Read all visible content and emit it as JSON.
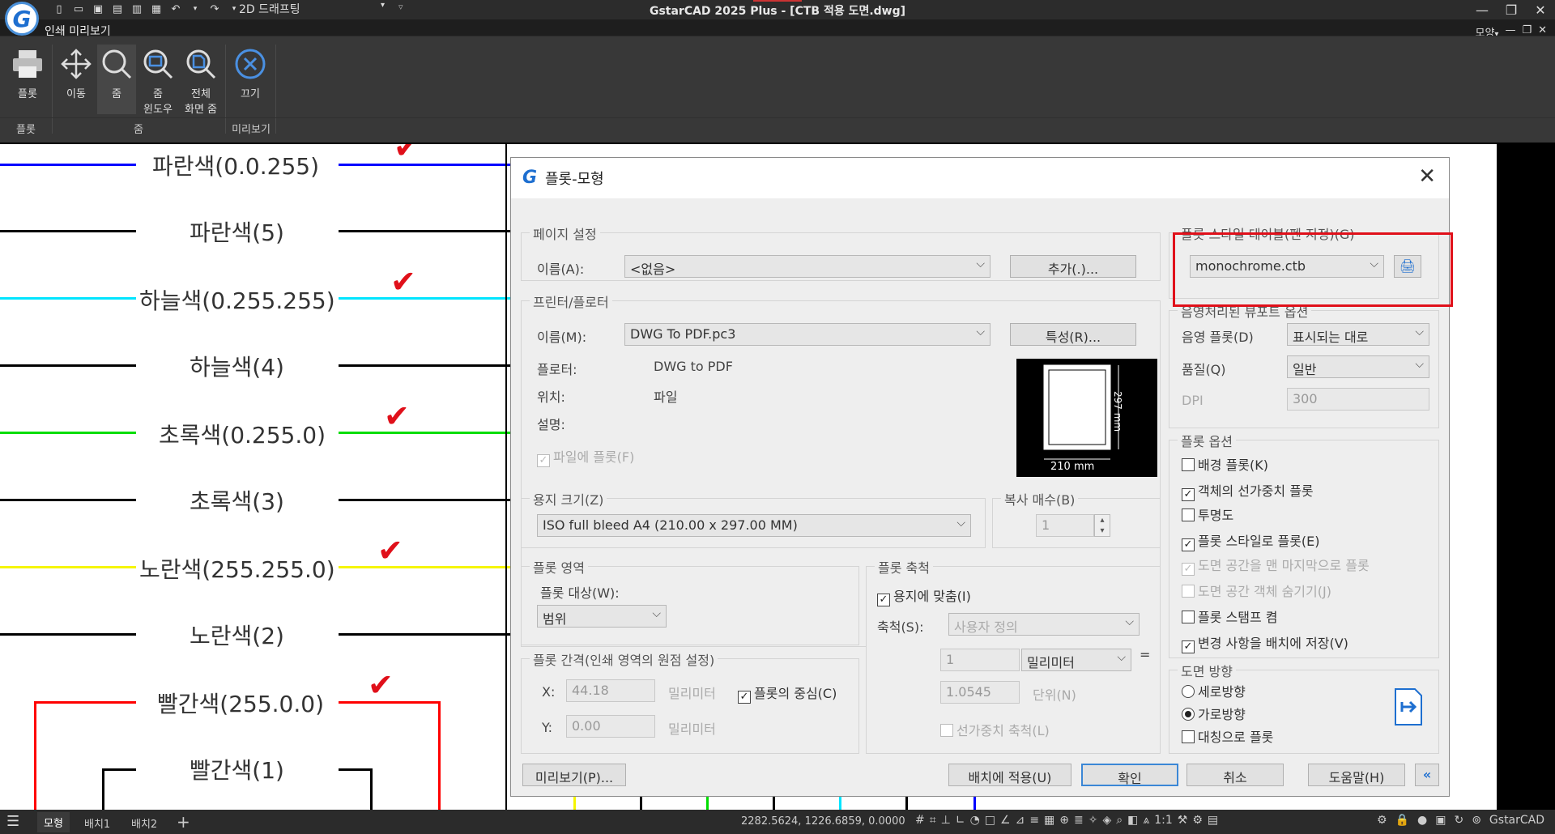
{
  "app": {
    "title": "GstarCAD 2025 Plus - [CTB 적용 도면.dwg]",
    "workspace": "2D 드래프팅",
    "logo_letter": "G"
  },
  "ribbon": {
    "tab": "인쇄 미리보기",
    "right_menu": "모양",
    "buttons": {
      "plot": "플롯",
      "pan": "이동",
      "zoom": "줌",
      "zoom_window_1": "줌",
      "zoom_window_2": "윈도우",
      "zoom_extents_1": "전체",
      "zoom_extents_2": "화면 줌",
      "close": "끄기"
    },
    "groups": {
      "plot": "플롯",
      "zoom": "줌",
      "preview": "미리보기"
    }
  },
  "canvas": {
    "labels": [
      "파란색(0.0.255)",
      "파란색(5)",
      "하늘색(0.255.255)",
      "하늘색(4)",
      "초록색(0.255.0)",
      "초록색(3)",
      "노란색(255.255.0)",
      "노란색(2)",
      "빨간색(255.0.0)",
      "빨간색(1)"
    ],
    "colors": {
      "blue": "#0000ff",
      "cyan": "#00e5ff",
      "green": "#00dd00",
      "yellow": "#f5f500",
      "red": "#ff0000",
      "black": "#000000",
      "check": "#e0101a"
    },
    "check_mark": "✔"
  },
  "dialog": {
    "title": "플롯-모형",
    "page_setup": {
      "title": "페이지 설정",
      "name_label": "이름(A):",
      "name_value": "<없음>",
      "add_button": "추가(.)..."
    },
    "printer": {
      "title": "프린터/플로터",
      "name_label": "이름(M):",
      "name_value": "DWG To PDF.pc3",
      "properties_button": "특성(R)...",
      "plotter_label": "플로터:",
      "plotter_value": "DWG to PDF",
      "location_label": "위치:",
      "location_value": "파일",
      "description_label": "설명:",
      "plot_to_file": "파일에 플롯(F)",
      "preview_width": "210 mm",
      "preview_height": "297 mm"
    },
    "paper_size": {
      "title": "용지 크기(Z)",
      "value": "ISO full bleed A4 (210.00 x 297.00 MM)"
    },
    "copies": {
      "title": "복사 매수(B)",
      "value": "1"
    },
    "plot_area": {
      "title": "플롯 영역",
      "what_label": "플롯 대상(W):",
      "what_value": "범위"
    },
    "plot_offset": {
      "title": "플롯 간격(인쇄 영역의 원점 설정)",
      "x_label": "X:",
      "x_value": "44.18",
      "y_label": "Y:",
      "y_value": "0.00",
      "unit": "밀리미터",
      "center": "플롯의 중심(C)"
    },
    "plot_scale": {
      "title": "플롯 축척",
      "fit": "용지에 맞춤(I)",
      "scale_label": "축척(S):",
      "scale_value": "사용자 정의",
      "value1": "1",
      "unit_value": "밀리미터",
      "equals": "=",
      "value2": "1.0545",
      "unit2": "단위(N)",
      "lineweights": "선가중치 축척(L)"
    },
    "style_table": {
      "title": "플롯 스타일 테이블(펜 지정)(G)",
      "value": "monochrome.ctb"
    },
    "shaded": {
      "title": "음영처리된 뷰포트 옵션",
      "shade_label": "음영 플롯(D)",
      "shade_value": "표시되는 대로",
      "quality_label": "품질(Q)",
      "quality_value": "일반",
      "dpi_label": "DPI",
      "dpi_value": "300"
    },
    "plot_options": {
      "title": "플롯 옵션",
      "background": "배경 플롯(K)",
      "lineweights": "객체의 선가중치 플롯",
      "transparency": "투명도",
      "with_styles": "플롯 스타일로 플롯(E)",
      "paperspace_last": "도면 공간을 맨 마지막으로 플롯",
      "hide_paperspace": "도면 공간 객체 숨기기(J)",
      "stamp": "플롯 스탬프 켬",
      "save_changes": "변경 사항을 배치에 저장(V)"
    },
    "orientation": {
      "title": "도면 방향",
      "portrait": "세로방향",
      "landscape": "가로방향",
      "upside_down": "대칭으로 플롯"
    },
    "buttons": {
      "preview": "미리보기(P)...",
      "apply": "배치에 적용(U)",
      "ok": "확인",
      "cancel": "취소",
      "help": "도움말(H)",
      "collapse": "«"
    },
    "highlight_color": "#e0101a"
  },
  "statusbar": {
    "tabs": [
      "모형",
      "배치1",
      "배치2"
    ],
    "add": "+",
    "coords": "2282.5624, 1226.6859, 0.0000",
    "scale": "1:1",
    "brand": "GstarCAD"
  }
}
